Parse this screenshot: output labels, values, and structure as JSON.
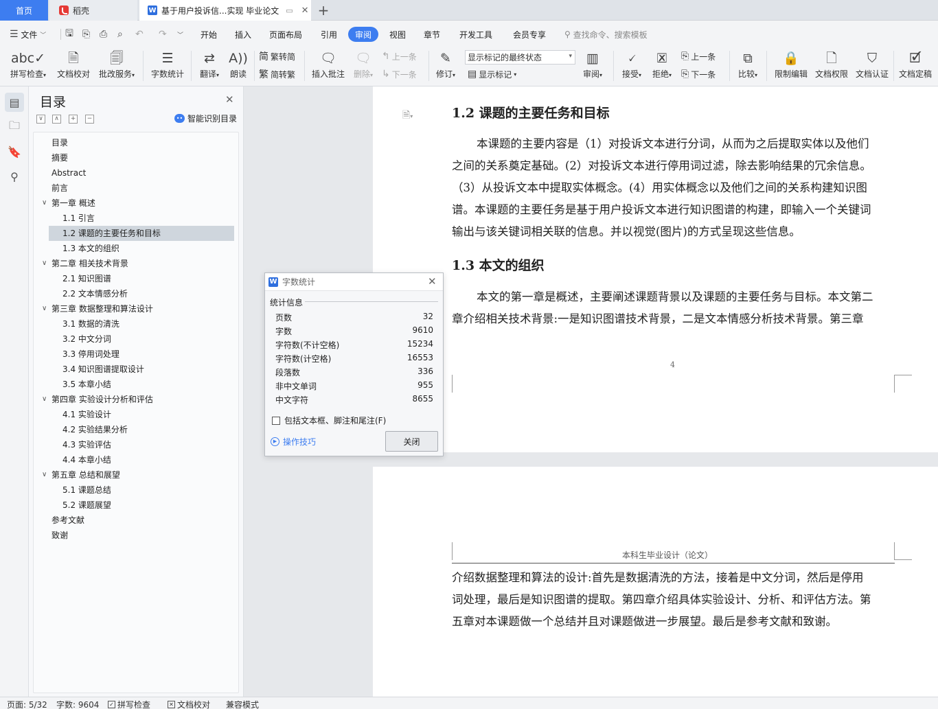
{
  "tabs": {
    "home": "首页",
    "daoke": "稻壳",
    "doc": "基于用户投诉信...实现 毕业论文",
    "add": "+"
  },
  "menu": {
    "file": "文件",
    "items": [
      "开始",
      "插入",
      "页面布局",
      "引用",
      "审阅",
      "视图",
      "章节",
      "开发工具",
      "会员专享"
    ],
    "active": "审阅",
    "search": "查找命令、搜索模板"
  },
  "ribbon": {
    "spell_check": "拼写检查",
    "doc_proof": "文档校对",
    "batch_service": "批改服务",
    "word_count": "字数统计",
    "translate": "翻译",
    "read_aloud": "朗读",
    "trad_to_simp": "繁转简",
    "simp_to_trad": "简转繁",
    "insert_comment": "插入批注",
    "delete": "删除",
    "prev_comment": "上一条",
    "next_comment": "下一条",
    "track_changes": "修订",
    "markup_select": "显示标记的最终状态",
    "show_markup": "显示标记",
    "review": "审阅",
    "accept": "接受",
    "reject": "拒绝",
    "prev_change": "上一条",
    "next_change": "下一条",
    "compare": "比较",
    "restrict_edit": "限制编辑",
    "doc_permission": "文档权限",
    "doc_certify": "文档认证",
    "doc_finalize": "文档定稿"
  },
  "toc": {
    "title": "目录",
    "smart": "智能识别目录",
    "items": [
      {
        "label": "目录",
        "level": 0
      },
      {
        "label": "摘要",
        "level": 0
      },
      {
        "label": "Abstract",
        "level": 0
      },
      {
        "label": "前言",
        "level": 0
      },
      {
        "label": "第一章 概述",
        "level": 1
      },
      {
        "label": "1.1 引言",
        "level": 2
      },
      {
        "label": "1.2  课题的主要任务和目标",
        "level": 2
      },
      {
        "label": "1.3 本文的组织",
        "level": 2
      },
      {
        "label": "第二章 相关技术背景",
        "level": 1
      },
      {
        "label": "2.1  知识图谱",
        "level": 2
      },
      {
        "label": "2.2 文本情感分析",
        "level": 2
      },
      {
        "label": "第三章 数据整理和算法设计",
        "level": 1
      },
      {
        "label": "3.1 数据的清洗",
        "level": 2
      },
      {
        "label": "3.2 中文分词",
        "level": 2
      },
      {
        "label": "3.3 停用词处理",
        "level": 2
      },
      {
        "label": "3.4 知识图谱提取设计",
        "level": 2
      },
      {
        "label": "3.5 本章小结",
        "level": 2
      },
      {
        "label": "第四章  实验设计分析和评估",
        "level": 1
      },
      {
        "label": "4.1 实验设计",
        "level": 2
      },
      {
        "label": "4.2 实验结果分析",
        "level": 2
      },
      {
        "label": "4.3 实验评估",
        "level": 2
      },
      {
        "label": "4.4 本章小结",
        "level": 2
      },
      {
        "label": "第五章  总结和展望",
        "level": 1
      },
      {
        "label": "5.1 课题总结",
        "level": 2
      },
      {
        "label": "5.2 课题展望",
        "level": 2
      },
      {
        "label": "参考文献",
        "level": 0
      },
      {
        "label": "致谢",
        "level": 0
      }
    ],
    "selected": 6
  },
  "doc": {
    "h_12": "1.2  课题的主要任务和目标",
    "p1": [
      "本课题的主要内容是（1）对投诉文本进行分词，从而为之后提取实体以及他们",
      "之间的关系奠定基础。(2）对投诉文本进行停用词过滤，除去影响结果的冗余信息。",
      "（3）从投诉文本中提取实体概念。(4）用实体概念以及他们之间的关系构建知识图",
      "谱。本课题的主要任务是基于用户投诉文本进行知识图谱的构建，即输入一个关键词",
      "输出与该关键词相关联的信息。并以视觉(图片)的方式呈现这些信息。"
    ],
    "h_13": "1.3 本文的组织",
    "p2": [
      "本文的第一章是概述，主要阐述课题背景以及课题的主要任务与目标。本文第二",
      "章介绍相关技术背景:一是知识图谱技术背景，二是文本情感分析技术背景。第三章"
    ],
    "page_number": "4",
    "header2": "本科生毕业设计（论文）",
    "p3": [
      "介绍数据整理和算法的设计:首先是数据清洗的方法，接着是中文分词，然后是停用",
      "词处理，最后是知识图谱的提取。第四章介绍具体实验设计、分析、和评估方法。第",
      "五章对本课题做一个总结并且对课题做进一步展望。最后是参考文献和致谢。"
    ]
  },
  "dialog": {
    "title": "字数统计",
    "section": "统计信息",
    "rows": [
      {
        "label": "页数",
        "value": "32"
      },
      {
        "label": "字数",
        "value": "9610"
      },
      {
        "label": "字符数(不计空格)",
        "value": "15234"
      },
      {
        "label": "字符数(计空格)",
        "value": "16553"
      },
      {
        "label": "段落数",
        "value": "336"
      },
      {
        "label": "非中文单词",
        "value": "955"
      },
      {
        "label": "中文字符",
        "value": "8655"
      }
    ],
    "checkbox": "包括文本框、脚注和尾注(F)",
    "tips": "操作技巧",
    "close": "关闭"
  },
  "status": {
    "page": "页面: 5/32",
    "words": "字数: 9604",
    "spell": "拼写检查",
    "proof": "文档校对",
    "compat": "兼容模式"
  },
  "colors": {
    "accent": "#3d7df0",
    "toc_selected": "#cfd6dd",
    "tips": "#3d7df0"
  }
}
